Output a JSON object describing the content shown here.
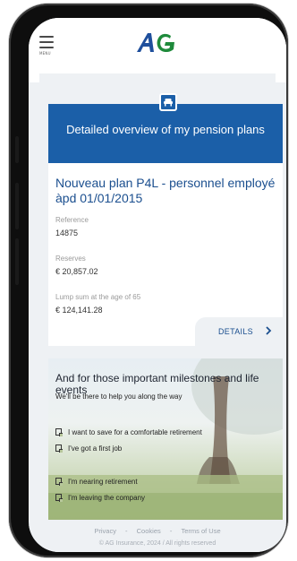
{
  "header": {
    "menu_label": "MENU",
    "logo_text": "AG"
  },
  "card": {
    "title": "Detailed overview of my pension plans",
    "plan_name": "Nouveau plan P4L - personnel employé àpd 01/01/2015",
    "fields": [
      {
        "label": "Reference",
        "value": "14875"
      },
      {
        "label": "Reserves",
        "value": "€ 20,857.02"
      },
      {
        "label": "Lump sum at the age of 65",
        "value": "€ 124,141.28"
      }
    ],
    "details_label": "DETAILS"
  },
  "milestones": {
    "title": "And for those important milestones and life events",
    "subtitle": "We'll be there to help you along the way",
    "options": [
      "I want to save for a comfortable retirement",
      "I've got a first job",
      "I'm nearing retirement",
      "I'm leaving the company"
    ]
  },
  "footer": {
    "links": [
      "Privacy",
      "Cookies",
      "Terms of Use"
    ],
    "separator": "-",
    "copyright": "© AG Insurance, 2024 / All rights reserved"
  },
  "colors": {
    "brand_blue": "#1b5fa8",
    "plan_text": "#1b4f8f",
    "logo_green": "#1f8a3b",
    "logo_blue": "#1f4f9c"
  }
}
